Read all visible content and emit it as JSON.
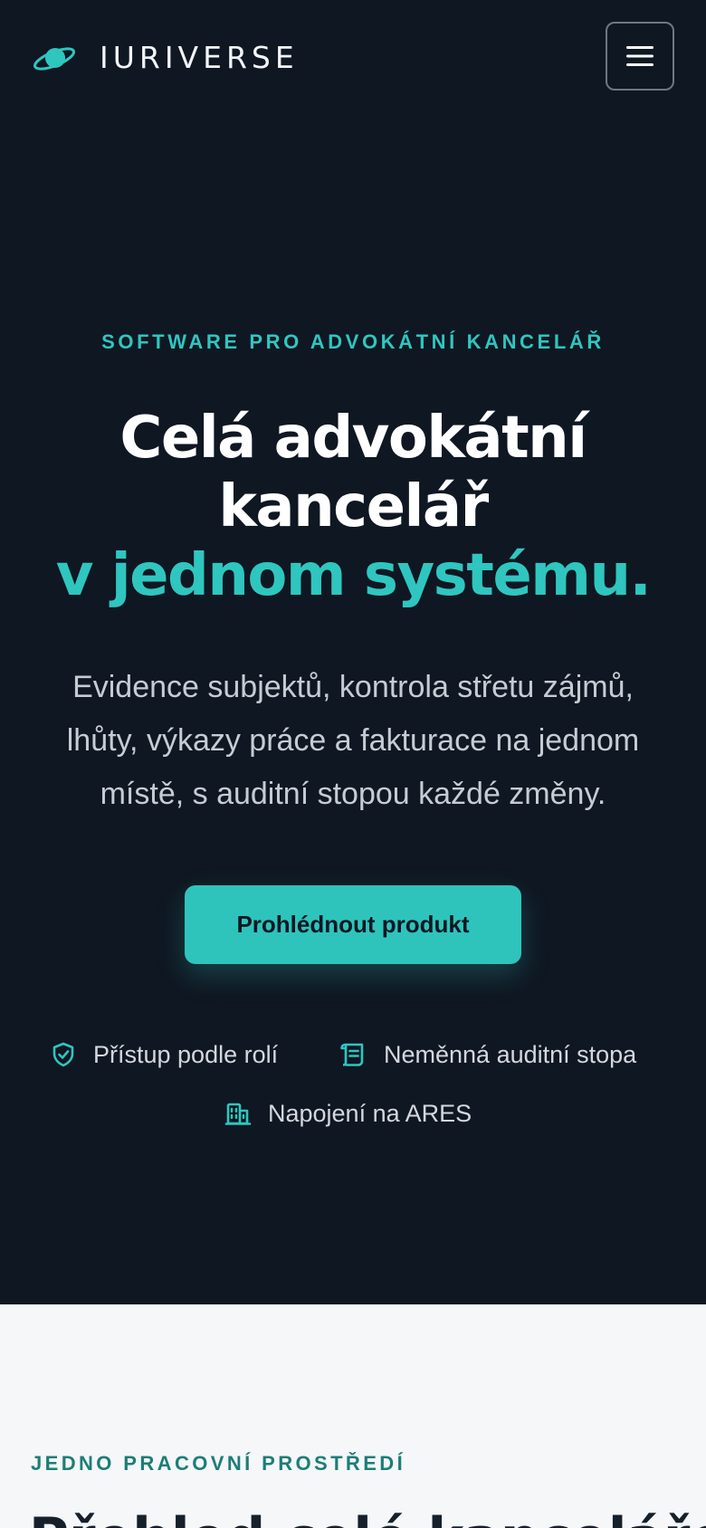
{
  "header": {
    "brand": "IURIVERSE",
    "logo_icon": "planet-ring-icon",
    "menu_icon": "hamburger-menu-icon"
  },
  "hero": {
    "eyebrow": "SOFTWARE PRO ADVOKÁTNÍ KANCELÁŘ",
    "headline_line1": "Celá advokátní",
    "headline_line2": "kancelář",
    "headline_accent": "v jednom systému.",
    "subtitle": "Evidence subjektů, kontrola střetu zájmů, lhůty, výkazy práce a fakturace na jednom místě, s auditní stopou každé změny.",
    "cta_label": "Prohlédnout produkt",
    "features": [
      {
        "icon": "shield-check-icon",
        "label": "Přístup podle rolí"
      },
      {
        "icon": "scroll-icon",
        "label": "Neměnná auditní stopa"
      },
      {
        "icon": "building-icon",
        "label": "Napojení na ARES"
      }
    ]
  },
  "section2": {
    "eyebrow": "JEDNO PRACOVNÍ PROSTŘEDÍ",
    "heading": "Přehled celé kanceláře"
  },
  "colors": {
    "background_dark": "#0f1722",
    "accent": "#2fc6bf",
    "text_light": "#ffffff",
    "text_muted": "#c6ccd3",
    "section_light": "#f5f7f9",
    "eyebrow_dark": "#1d7d77"
  }
}
